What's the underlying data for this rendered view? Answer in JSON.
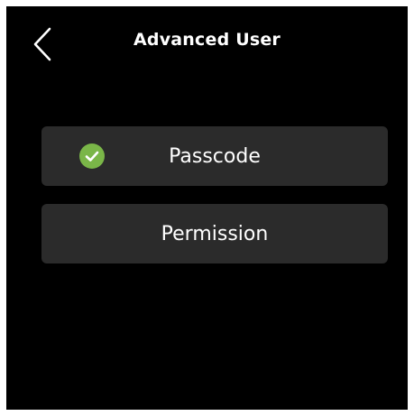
{
  "header": {
    "title": "Advanced User",
    "back_icon": "chevron-left-icon"
  },
  "menu": {
    "items": [
      {
        "label": "Passcode",
        "icon": "check-circle-icon",
        "icon_color": "#7ab648"
      },
      {
        "label": "Permission"
      }
    ]
  },
  "colors": {
    "background": "#000000",
    "item_background": "#2b2b2b",
    "text": "#ffffff",
    "accent": "#7ab648"
  }
}
